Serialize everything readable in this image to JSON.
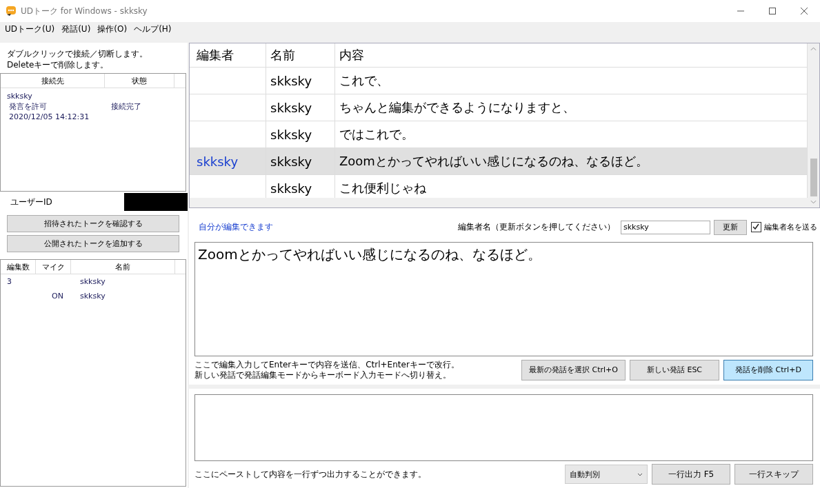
{
  "window": {
    "title": "UDトーク for Windows - skksky"
  },
  "menu": [
    "UDトーク(U)",
    "発話(U)",
    "操作(O)",
    "ヘルプ(H)"
  ],
  "sidebar": {
    "hint": [
      "ダブルクリックで接続／切断します。",
      "Deleteキーで削除します。"
    ],
    "connections": {
      "columns": [
        "接続先",
        "状態"
      ],
      "rows": [
        {
          "name": "skksky",
          "permission": "発言を許可",
          "status": "接続完了",
          "time": "2020/12/05 14:12:31"
        }
      ]
    },
    "user_id_label": "ユーザーID",
    "buttons": [
      "招待されたトークを確認する",
      "公開されたトークを追加する"
    ],
    "members": {
      "columns": [
        "編集数",
        "マイク",
        "名前"
      ],
      "rows": [
        {
          "edits": "3",
          "mic": "",
          "name": "skksky"
        },
        {
          "edits": "",
          "mic": "ON",
          "name": "skksky"
        }
      ]
    }
  },
  "table": {
    "columns": [
      "編集者",
      "名前",
      "内容"
    ],
    "rows": [
      {
        "editor": "",
        "name": "skksky",
        "content": "これで、",
        "selected": false
      },
      {
        "editor": "",
        "name": "skksky",
        "content": "ちゃんと編集ができるようになりますと、",
        "selected": false
      },
      {
        "editor": "",
        "name": "skksky",
        "content": "ではこれで。",
        "selected": false
      },
      {
        "editor": "skksky",
        "name": "skksky",
        "content": "Zoomとかってやればいい感じになるのね、なるほど。",
        "selected": true
      },
      {
        "editor": "",
        "name": "skksky",
        "content": "これ便利じゃね",
        "selected": false
      }
    ]
  },
  "editor": {
    "status": "自分が編集できます",
    "name_label": "編集者名（更新ボタンを押してください）",
    "name_value": "skksky",
    "update_button": "更新",
    "send_name": {
      "label": "編集者名を送る",
      "checked": true
    },
    "text": "Zoomとかってやればいい感じになるのね、なるほど。",
    "hint": [
      "ここで編集入力してEnterキーで内容を送信、Ctrl+Enterキーで改行。",
      "新しい発話で発話編集モードからキーボード入力モードへ切り替え。"
    ],
    "buttons": [
      {
        "label": "最新の発話を選択 Ctrl+O",
        "focused": false
      },
      {
        "label": "新しい発話 ESC",
        "focused": false
      },
      {
        "label": "発話を削除 Ctrl+D",
        "focused": true
      }
    ]
  },
  "paste": {
    "hint": "ここにペーストして内容を一行ずつ出力することができます。",
    "mode": "自動判別",
    "buttons": [
      "一行出力 F5",
      "一行スキップ"
    ]
  }
}
